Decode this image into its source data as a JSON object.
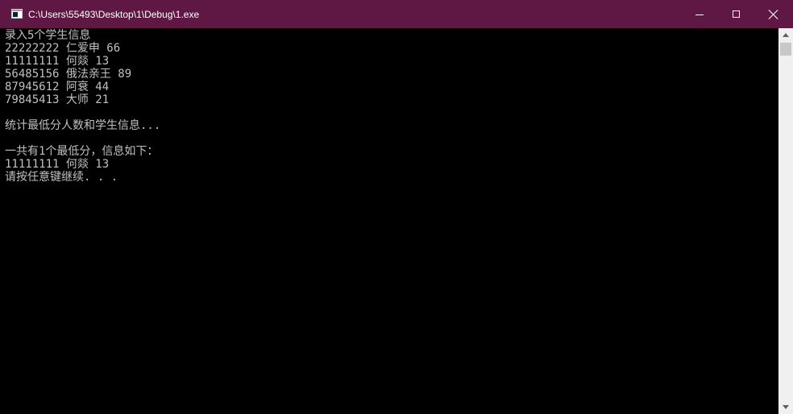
{
  "window": {
    "title": "C:\\Users\\55493\\Desktop\\1\\Debug\\1.exe",
    "title_bar_color": "#5e1843",
    "app_icon": "console-app-icon",
    "controls": {
      "minimize_icon": "minimize-icon",
      "maximize_icon": "maximize-icon",
      "close_icon": "close-icon"
    }
  },
  "console": {
    "background": "#000000",
    "text_color": "#c0c0c0",
    "lines": [
      "录入5个学生信息",
      "22222222 仁爱申 66",
      "11111111 何燚 13",
      "56485156 俄法亲王 89",
      "87945612 阿衰 44",
      "79845413 大师 21",
      "",
      "统计最低分人数和学生信息...",
      "",
      "一共有1个最低分，信息如下：",
      "11111111 何燚 13",
      "请按任意键继续. . ."
    ]
  },
  "scrollbar": {
    "up_icon": "scroll-up-icon",
    "down_icon": "scroll-down-icon"
  }
}
